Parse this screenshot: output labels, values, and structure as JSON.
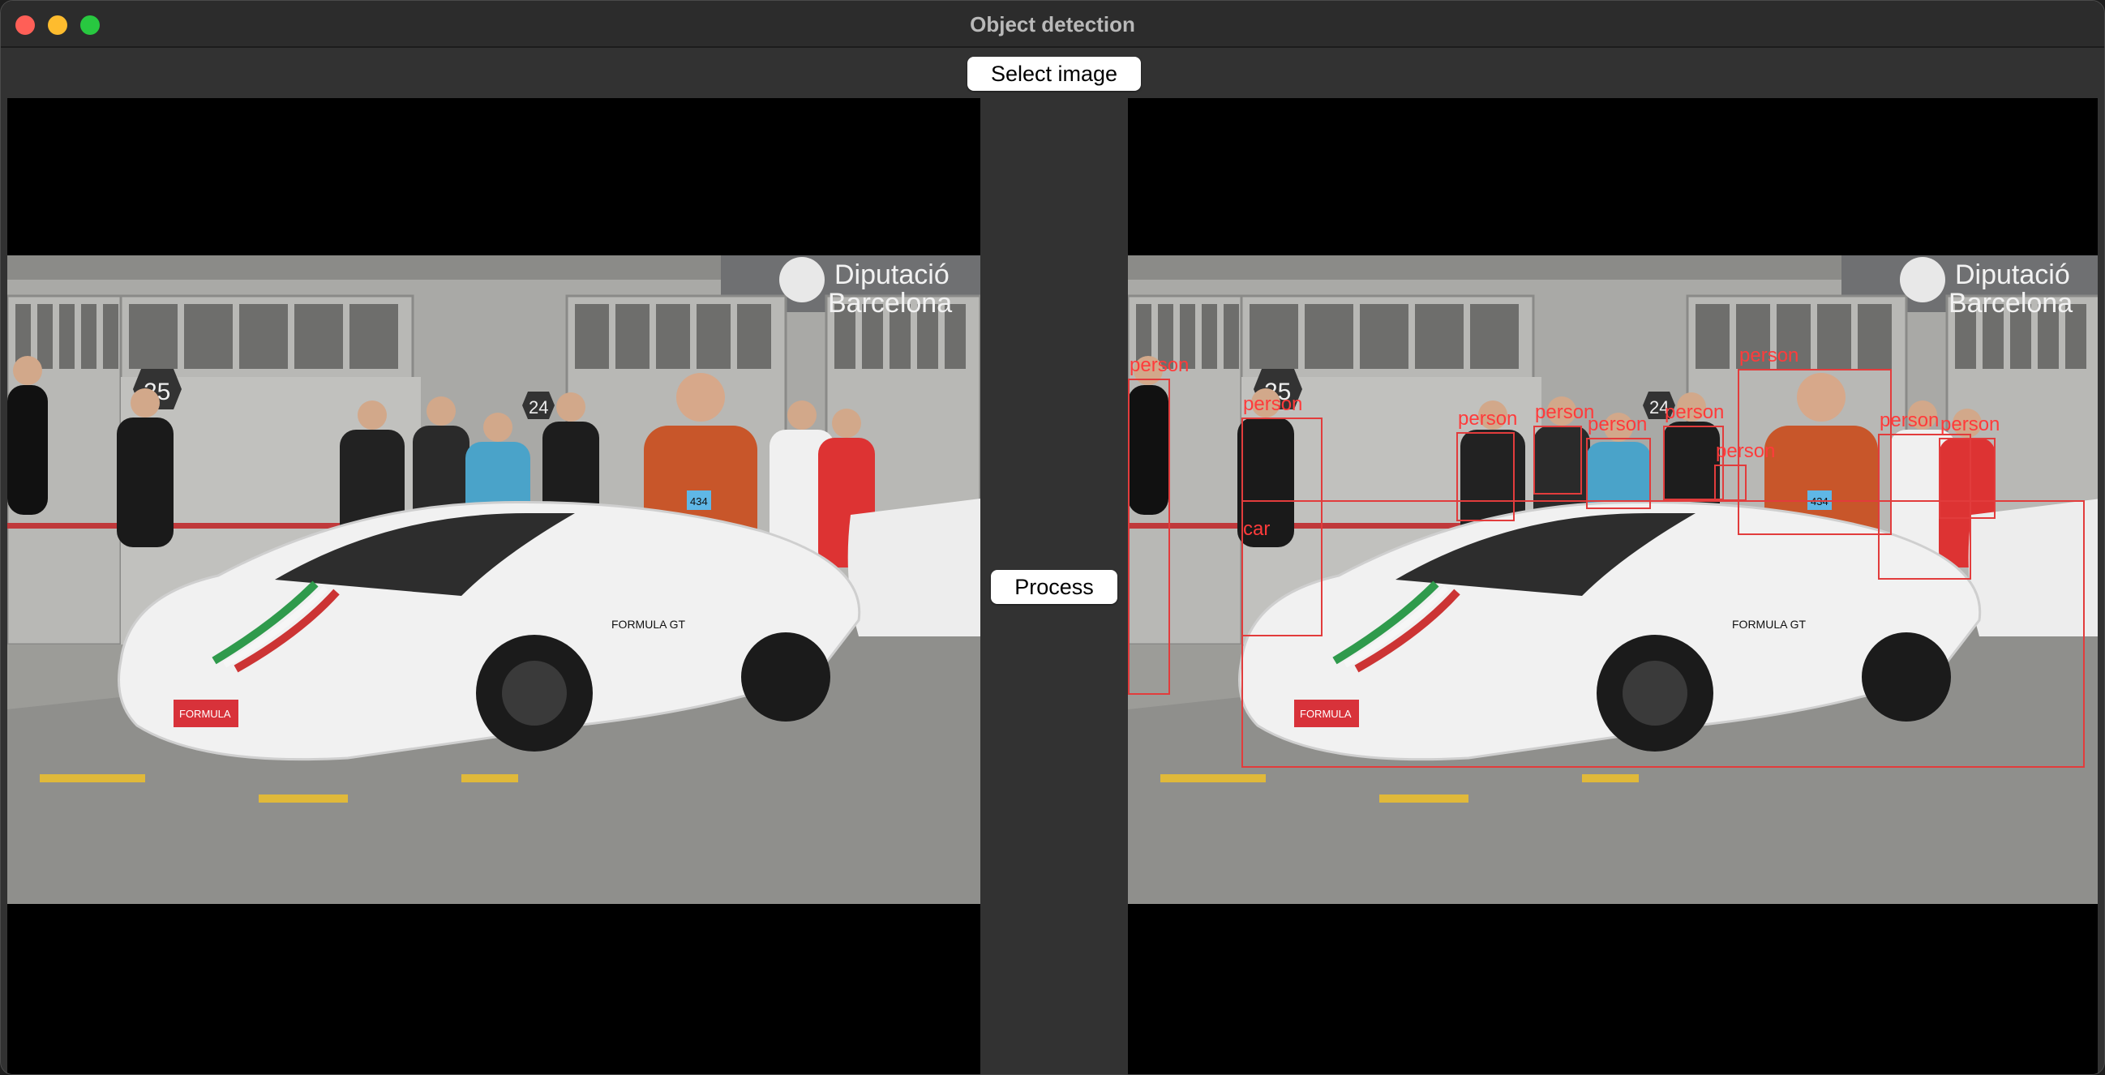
{
  "window": {
    "title": "Object detection"
  },
  "toolbar": {
    "select_label": "Select image"
  },
  "middle": {
    "process_label": "Process"
  },
  "scene": {
    "sign_text": [
      "Diputació",
      "Barcelona"
    ],
    "garage_numbers": [
      "25",
      "24"
    ],
    "badge_number": "434",
    "car_decal": "FORMULA GT",
    "plate_text": "FORMULA"
  },
  "detections": [
    {
      "label": "person"
    },
    {
      "label": "person"
    },
    {
      "label": "car"
    },
    {
      "label": "person"
    },
    {
      "label": "person"
    },
    {
      "label": "person"
    },
    {
      "label": "person"
    },
    {
      "label": "person"
    },
    {
      "label": "person"
    },
    {
      "label": "person"
    },
    {
      "label": "person"
    }
  ],
  "colors": {
    "box": "#e23c3c",
    "label": "#ff3b3b"
  }
}
